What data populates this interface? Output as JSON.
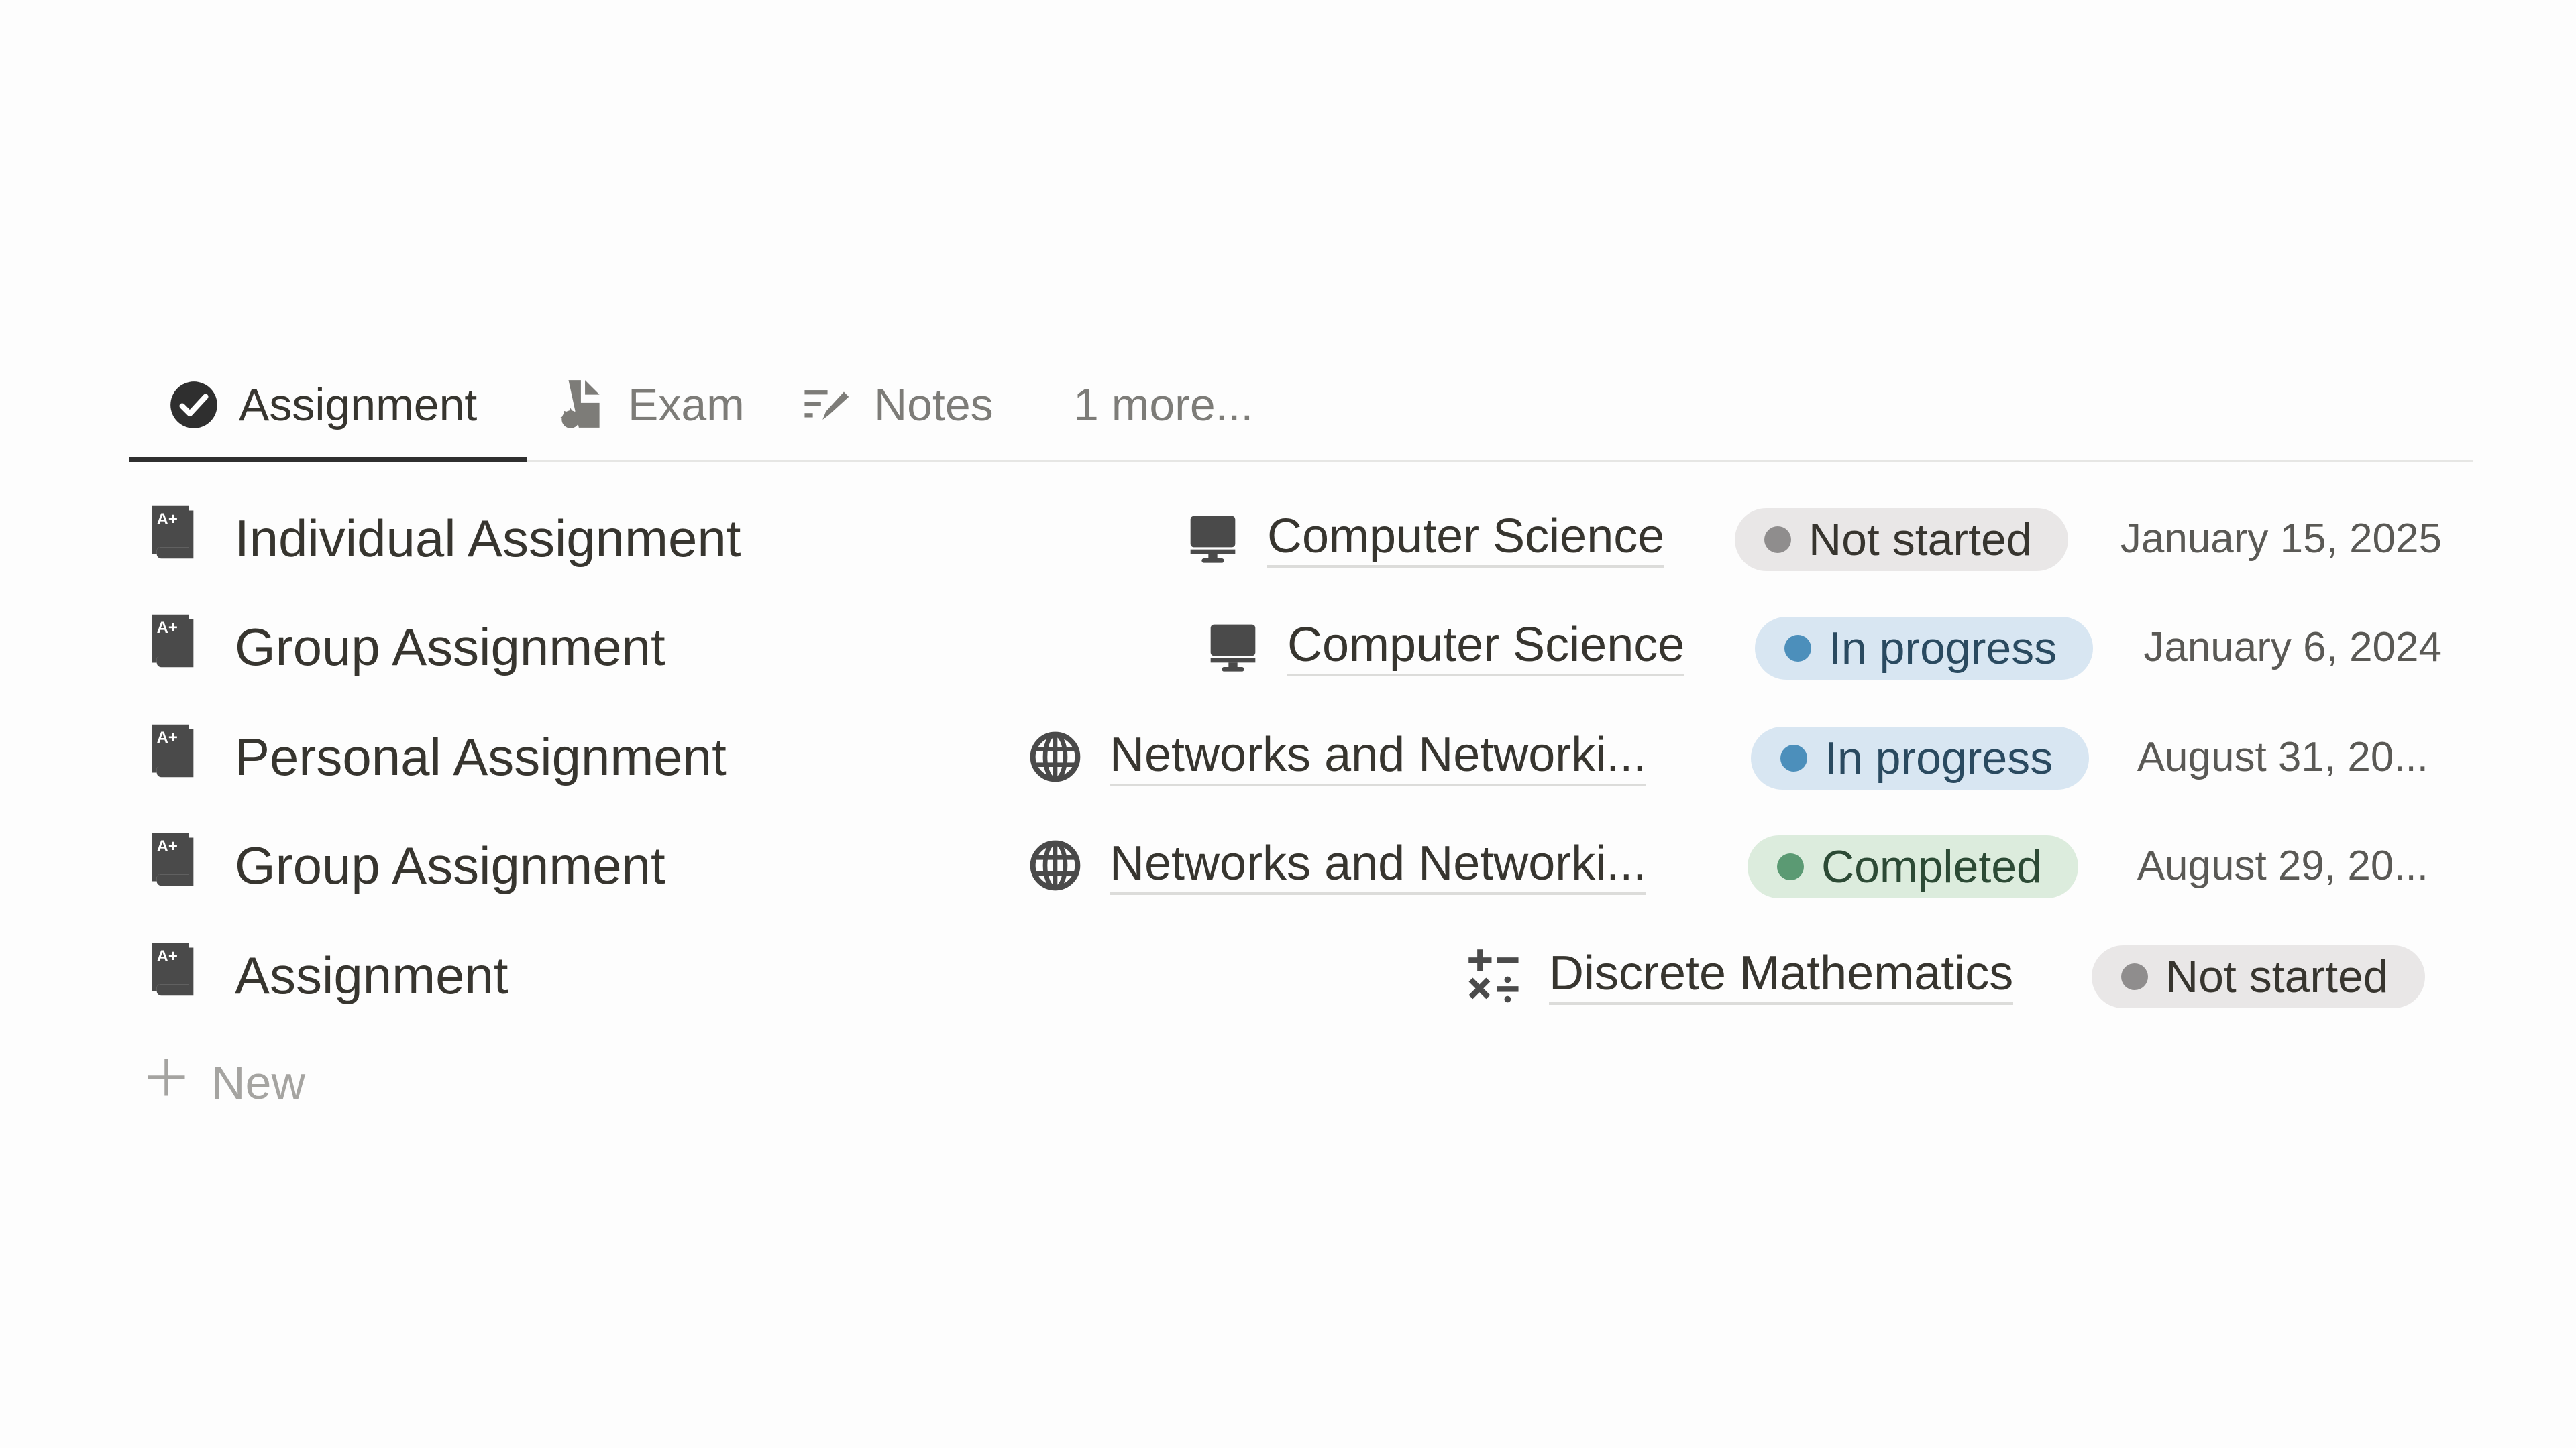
{
  "tabs": [
    {
      "label": "Assignment",
      "icon": "check-circle-icon",
      "active": true
    },
    {
      "label": "Exam",
      "icon": "exam-document-badge-icon",
      "active": false
    },
    {
      "label": "Notes",
      "icon": "notes-pencil-icon",
      "active": false
    },
    {
      "label": "1 more...",
      "icon": null,
      "active": false
    }
  ],
  "rows": [
    {
      "title": "Individual Assignment",
      "icon": "grade-book-icon",
      "course": {
        "label": "Computer Science",
        "icon": "monitor-icon"
      },
      "status": {
        "label": "Not started",
        "kind": "not_started"
      },
      "date": "January 15, 2025"
    },
    {
      "title": "Group Assignment",
      "icon": "grade-book-icon",
      "course": {
        "label": "Computer Science",
        "icon": "monitor-icon"
      },
      "status": {
        "label": "In progress",
        "kind": "in_progress"
      },
      "date": "January 6, 2024"
    },
    {
      "title": "Personal Assignment",
      "icon": "grade-book-icon",
      "course": {
        "label": "Networks and Networki...",
        "icon": "globe-icon"
      },
      "status": {
        "label": "In progress",
        "kind": "in_progress"
      },
      "date": "August 31, 20..."
    },
    {
      "title": "Group Assignment",
      "icon": "grade-book-icon",
      "course": {
        "label": "Networks and Networki...",
        "icon": "globe-icon"
      },
      "status": {
        "label": "Completed",
        "kind": "completed"
      },
      "date": "August 29, 20..."
    },
    {
      "title": "Assignment",
      "icon": "grade-book-icon",
      "course": {
        "label": "Discrete Mathematics",
        "icon": "math-operators-icon"
      },
      "status": {
        "label": "Not started",
        "kind": "not_started"
      },
      "date": ""
    }
  ],
  "new_button": {
    "label": "New",
    "icon": "plus-icon"
  },
  "status_colors": {
    "not_started": {
      "bg": "#e9e7e7",
      "dot": "#8f8d8d",
      "text": "#37352f"
    },
    "in_progress": {
      "bg": "#d8e6f2",
      "dot": "#4c8fbb",
      "text": "#2a4a60"
    },
    "completed": {
      "bg": "#dcecdd",
      "dot": "#5b9a73",
      "text": "#2c4a35"
    }
  }
}
